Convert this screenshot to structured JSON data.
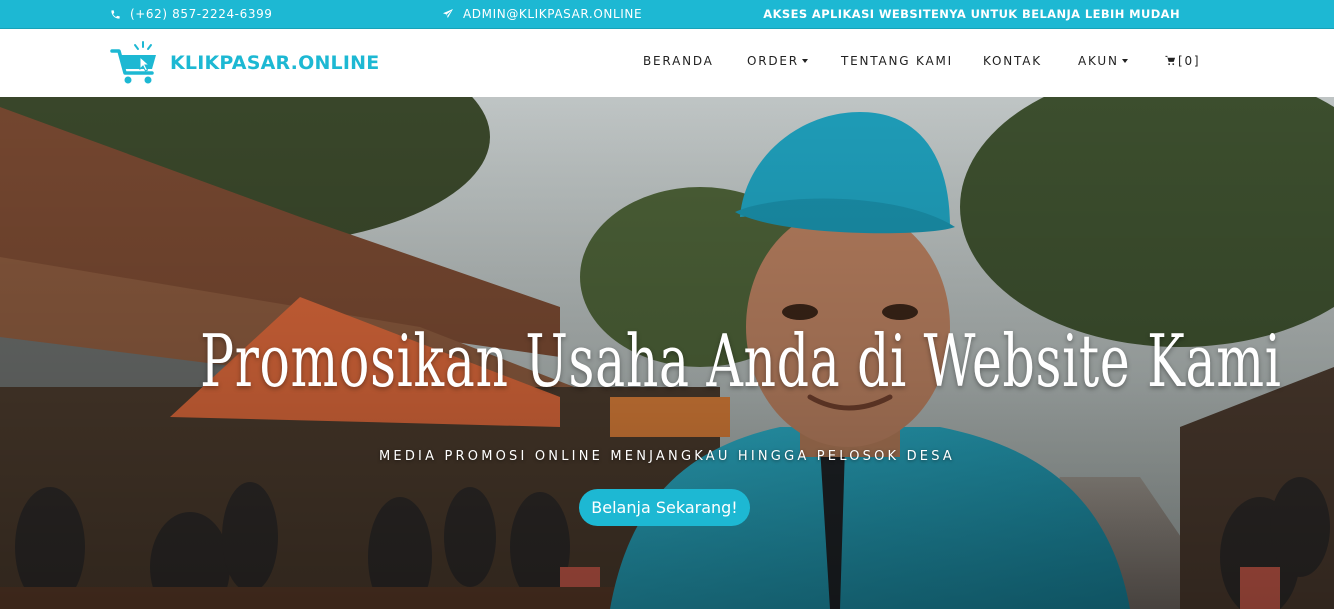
{
  "topbar": {
    "phone": "(+62) 857-2224-6399",
    "email": "ADMIN@KLIKPASAR.ONLINE",
    "tagline": "AKSES APLIKASI WEBSITENYA UNTUK BELANJA LEBIH MUDAH",
    "background_color": "#1db8d3"
  },
  "brand": {
    "name": "KLIKPASAR.ONLINE",
    "color": "#1db8d3",
    "logo_icon": "shopping-cart-cursor-icon"
  },
  "nav": {
    "items": [
      {
        "label": "BERANDA",
        "dropdown": false
      },
      {
        "label": "ORDER",
        "dropdown": true
      },
      {
        "label": "TENTANG KAMI",
        "dropdown": false
      },
      {
        "label": "KONTAK",
        "dropdown": false
      },
      {
        "label": "AKUN",
        "dropdown": true
      }
    ],
    "cart_label": "[0]",
    "cart_icon": "cart-icon"
  },
  "hero": {
    "title": "Promosikan Usaha Anda di Website Kami",
    "subtitle": "MEDIA PROMOSI ONLINE MENJANGKAU HINGGA PELOSOK DESA",
    "button_label": "Belanja Sekarang!",
    "button_color": "#1db8d3"
  }
}
